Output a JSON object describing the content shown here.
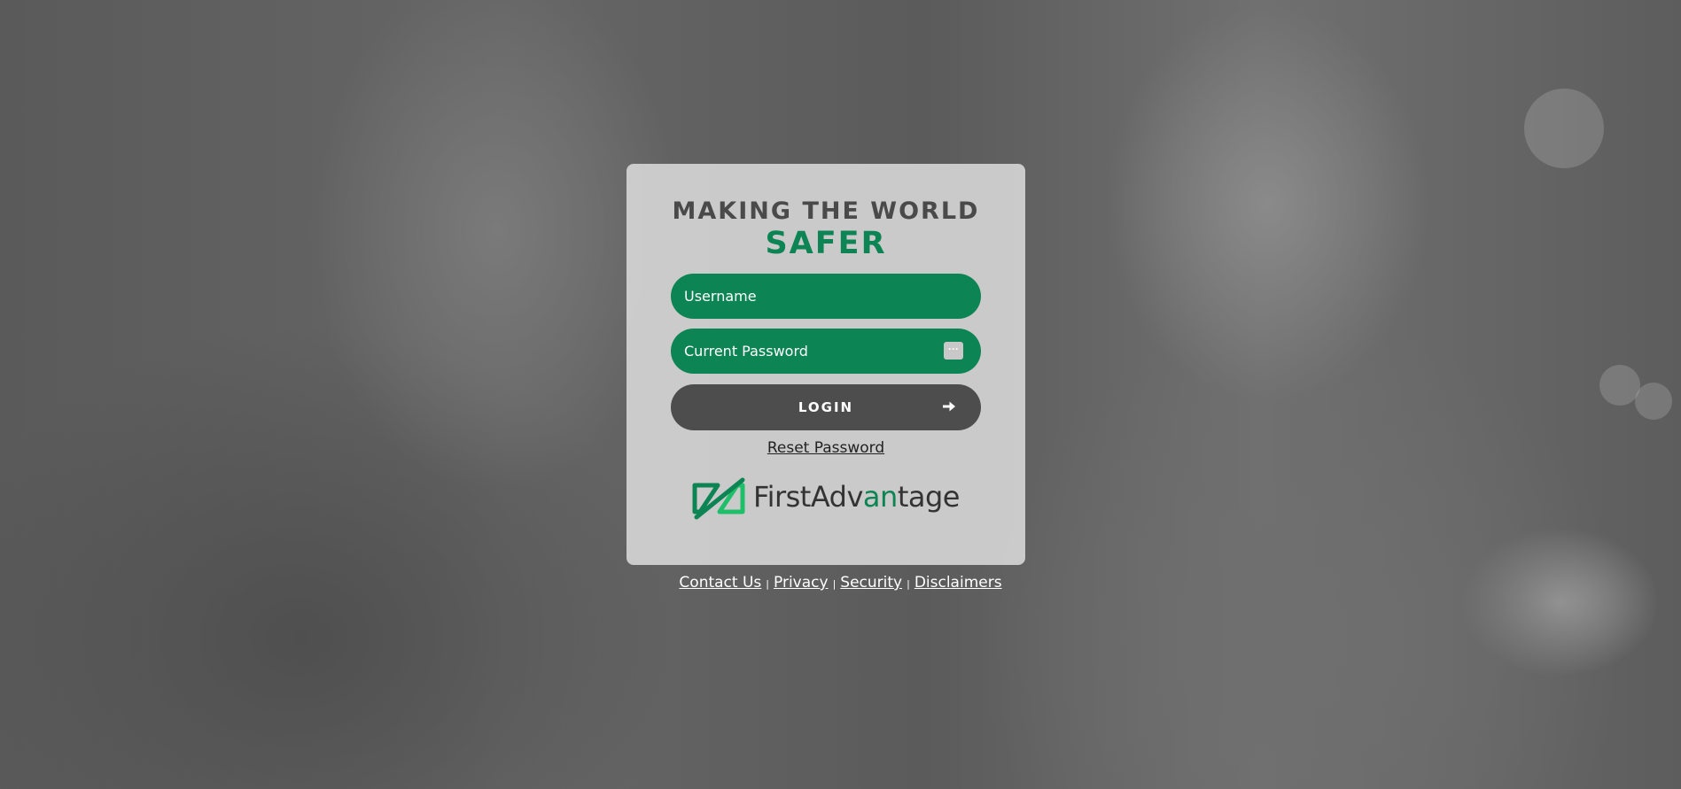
{
  "headline": {
    "line1": "MAKING THE WORLD",
    "line2": "SAFER"
  },
  "form": {
    "username_placeholder": "Username",
    "password_placeholder": "Current Password",
    "login_label": "LOGIN",
    "reset_link": "Reset Password"
  },
  "logo": {
    "part1": "FirstAdv",
    "part2": "an",
    "part3": "tage"
  },
  "footer": {
    "links": [
      "Contact Us",
      "Privacy",
      "Security",
      "Disclaimers"
    ],
    "separator": "|"
  },
  "colors": {
    "brand_green": "#0c8453",
    "button_dark": "#4d4d4d",
    "card_bg": "#dcdcdc"
  },
  "icons": {
    "password_manager": "password-dots-icon",
    "login_arrow": "arrow-right-icon",
    "logo_mark": "first-advantage-logo-icon"
  }
}
